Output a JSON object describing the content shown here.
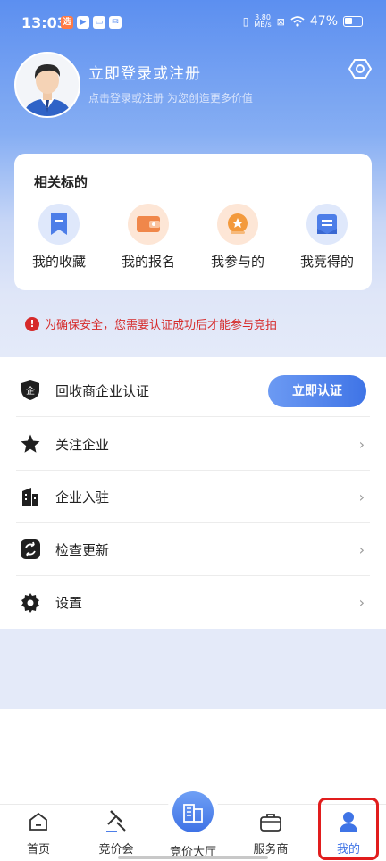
{
  "status_bar": {
    "time": "13:03",
    "net_speed_top": "3.80",
    "net_speed_bottom": "MB/s",
    "battery": "47%"
  },
  "profile": {
    "title": "立即登录或注册",
    "subtitle": "点击登录或注册 为您创造更多价值"
  },
  "related": {
    "title": "相关标的",
    "items": [
      {
        "label": "我的收藏",
        "icon": "bookmark-icon"
      },
      {
        "label": "我的报名",
        "icon": "wallet-icon"
      },
      {
        "label": "我参与的",
        "icon": "star-badge-icon"
      },
      {
        "label": "我竞得的",
        "icon": "document-icon"
      }
    ]
  },
  "warning": {
    "text": "为确保安全，您需要认证成功后才能参与竞拍",
    "icon": "exclamation-icon"
  },
  "menu": {
    "verify": {
      "label": "回收商企业认证",
      "button": "立即认证",
      "icon": "shield-enterprise-icon"
    },
    "follow": {
      "label": "关注企业",
      "icon": "star-icon"
    },
    "join": {
      "label": "企业入驻",
      "icon": "building-icon"
    },
    "update": {
      "label": "检查更新",
      "icon": "refresh-icon"
    },
    "settings": {
      "label": "设置",
      "icon": "gear-icon"
    }
  },
  "tabs": {
    "home": "首页",
    "auction": "竞价会",
    "hall": "竞价大厅",
    "service": "服务商",
    "mine": "我的"
  },
  "colors": {
    "accent": "#3f74e6",
    "warning": "#d62a2a",
    "highlight": "#e11d1d"
  }
}
